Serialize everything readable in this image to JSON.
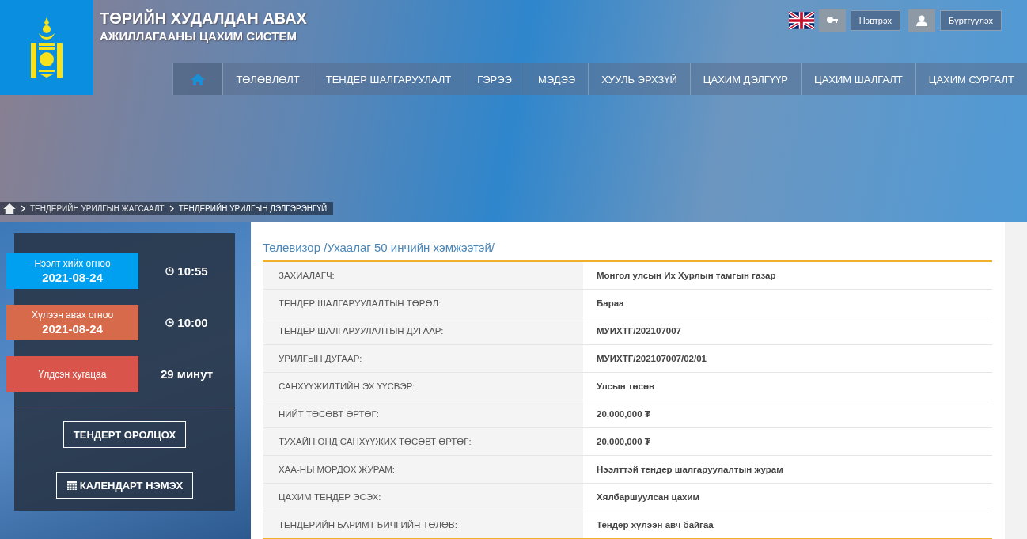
{
  "header": {
    "title_line_1": "ТӨРИЙН ХУДАЛДАН АВАХ",
    "title_line_2": "АЖИЛЛАГААНЫ ЦАХИМ СИСТЕМ",
    "login": "Нэвтрэх",
    "register": "Бүртгүүлэх"
  },
  "nav": [
    "ТӨЛӨВЛӨЛТ",
    "ТЕНДЕР ШАЛГАРУУЛАЛТ",
    "ГЭРЭЭ",
    "МЭДЭЭ",
    "ХУУЛЬ ЭРХЗҮЙ",
    "ЦАХИМ ДЭЛГҮҮР",
    "ЦАХИМ ШАЛГАЛТ",
    "ЦАХИМ СУРГАЛТ"
  ],
  "breadcrumb": [
    "ТЕНДЕРИЙН УРИЛГЫН ЖАГСААЛТ",
    "ТЕНДЕРИЙН УРИЛГЫН ДЭЛГЭРЭНГҮЙ"
  ],
  "sidebar": {
    "cards": [
      {
        "kind": "date",
        "label": "Нээлт хийх огноо",
        "date": "2021-08-24",
        "value": "10:55",
        "color": "#00a0f0"
      },
      {
        "kind": "date",
        "label": "Хүлээн авах огноо",
        "date": "2021-08-24",
        "value": "10:00",
        "color": "#d86a4c"
      },
      {
        "kind": "remaining",
        "label": "Үлдсэн хугацаа",
        "value": "29 минут",
        "color": "#d9544a"
      }
    ],
    "buttons": [
      "ТЕНДЕРТ ОРОЛЦОХ",
      "КАЛЕНДАРТ НЭМЭХ"
    ]
  },
  "detail": {
    "title": "Телевизор /Ухаалаг 50 инчийн хэмжээтэй/",
    "rows": [
      {
        "label": "ЗАХИАЛАГЧ:",
        "value": "Монгол улсын Их Хурлын тамгын газар"
      },
      {
        "label": "ТЕНДЕР ШАЛГАРУУЛАЛТЫН ТӨРӨЛ:",
        "value": "Бараа"
      },
      {
        "label": "ТЕНДЕР ШАЛГАРУУЛАЛТЫН ДУГААР:",
        "value": "МУИХТГ/202107007"
      },
      {
        "label": "УРИЛГЫН ДУГААР:",
        "value": "МУИХТГ/202107007/02/01"
      },
      {
        "label": "САНХҮҮЖИЛТИЙН ЭХ ҮҮСВЭР:",
        "value": "Улсын төсөв"
      },
      {
        "label": "НИЙТ ТӨСӨВТ ӨРТӨГ:",
        "value": "20,000,000 ₮"
      },
      {
        "label": "ТУХАЙН ОНД САНХҮҮЖИХ ТӨСӨВТ ӨРТӨГ:",
        "value": "20,000,000 ₮"
      },
      {
        "label": "ХАА-НЫ МӨРДӨХ ЖУРАМ:",
        "value": "Нээлттэй тендер шалгаруулалтын журам"
      },
      {
        "label": "ЦАХИМ ТЕНДЕР ЭСЭХ:",
        "value": "Хялбаршуулсан цахим"
      },
      {
        "label": "ТЕНДЕРИЙН БАРИМТ БИЧГИЙН ТӨЛӨВ:",
        "value": "Тендер хүлээн авч байгаа"
      }
    ]
  }
}
